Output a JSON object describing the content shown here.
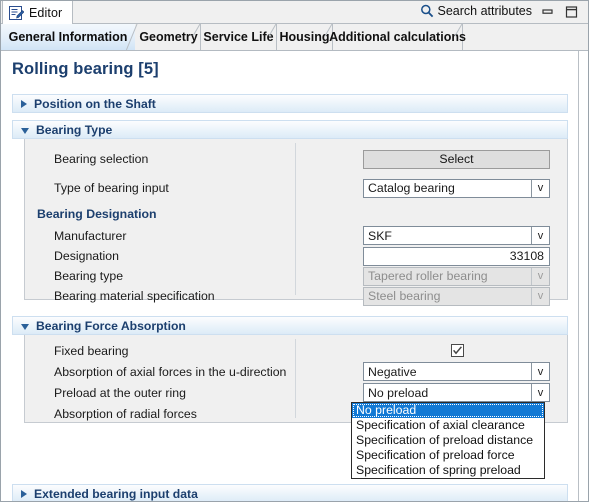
{
  "window": {
    "editor_tab_label": "Editor",
    "editor_tab_icon": "document-edit-icon",
    "search_label": "Search attributes",
    "search_icon": "search-icon",
    "minimize_icon": "minimize-icon",
    "maximize_icon": "maximize-icon"
  },
  "tabs": [
    {
      "label": "General Information",
      "active": true
    },
    {
      "label": "Geometry",
      "active": false
    },
    {
      "label": "Service Life",
      "active": false
    },
    {
      "label": "Housing",
      "active": false
    },
    {
      "label": "Additional calculations",
      "active": false
    }
  ],
  "page": {
    "title": "Rolling bearing [5]"
  },
  "sections": {
    "position_on_shaft": {
      "title": "Position on the Shaft",
      "expanded": false,
      "toggle_icon": "chevron-right-icon"
    },
    "bearing_type": {
      "title": "Bearing Type",
      "expanded": true,
      "toggle_icon": "chevron-down-icon",
      "rows": {
        "bearing_selection": {
          "label": "Bearing selection",
          "button_label": "Select"
        },
        "type_of_bearing_input": {
          "label": "Type of bearing input",
          "value": "Catalog bearing",
          "arrow": "v",
          "disabled": false
        },
        "bearing_designation_group": "Bearing Designation",
        "manufacturer": {
          "label": "Manufacturer",
          "value": "SKF",
          "arrow": "v",
          "disabled": false
        },
        "designation": {
          "label": "Designation",
          "value": "33108",
          "disabled": false
        },
        "bearing_type_field": {
          "label": "Bearing type",
          "value": "Tapered roller bearing",
          "arrow": "v",
          "disabled": true
        },
        "bearing_material_specification": {
          "label": "Bearing material specification",
          "value": "Steel bearing",
          "arrow": "v",
          "disabled": true
        }
      }
    },
    "bearing_force_absorption": {
      "title": "Bearing Force Absorption",
      "expanded": true,
      "toggle_icon": "chevron-down-icon",
      "rows": {
        "fixed_bearing": {
          "label": "Fixed bearing",
          "checked": true,
          "check_icon": "check-icon"
        },
        "absorption_axial_u": {
          "label": "Absorption of axial forces in the u-direction",
          "value": "Negative",
          "arrow": "v"
        },
        "preload_outer_ring": {
          "label": "Preload at the outer ring",
          "value": "No preload",
          "arrow": "v"
        },
        "absorption_radial": {
          "label": "Absorption of radial forces"
        }
      }
    },
    "extended_bearing_input_data": {
      "title": "Extended bearing input data",
      "expanded": false,
      "toggle_icon": "chevron-right-icon"
    }
  },
  "dropdown": {
    "open": true,
    "selected_index": 0,
    "options": [
      "No preload",
      "Specification of axial clearance",
      "Specification of preload distance",
      "Specification of preload force",
      "Specification of spring preload"
    ]
  },
  "colors": {
    "accent_blue": "#1c3f6e",
    "selection_blue": "#1279d4",
    "section_header_start": "#fcfdfe",
    "section_header_end": "#dcebf7",
    "panel_gray": "#f0f0f0"
  }
}
